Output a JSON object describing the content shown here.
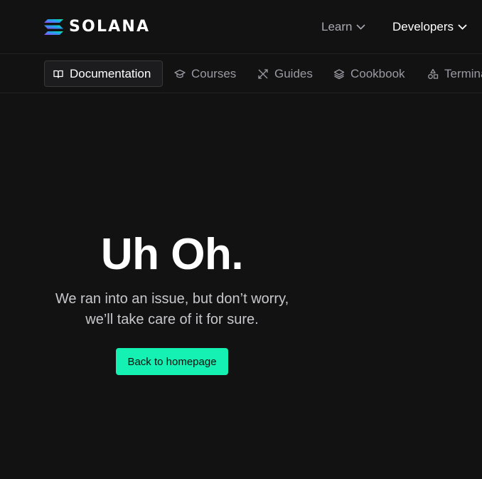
{
  "brand": {
    "name": "SOLANA",
    "logo_icon": "solana-logo-icon",
    "gradient": [
      "#9945ff",
      "#14f195",
      "#19fb9b"
    ]
  },
  "header": {
    "nav": [
      {
        "label": "Learn",
        "icon": "chevron-down-icon"
      },
      {
        "label": "Developers",
        "icon": "chevron-down-icon"
      }
    ]
  },
  "subnav": {
    "tabs": [
      {
        "label": "Documentation",
        "icon": "book-icon",
        "active": true
      },
      {
        "label": "Courses",
        "icon": "graduation-cap-icon"
      },
      {
        "label": "Guides",
        "icon": "tools-icon"
      },
      {
        "label": "Cookbook",
        "icon": "layers-icon"
      },
      {
        "label": "Terminal",
        "icon": "shapes-icon"
      }
    ]
  },
  "error": {
    "title": "Uh Oh.",
    "line1": "We ran into an issue, but don’t worry,",
    "line2": "we’ll take care of it for sure.",
    "button_label": "Back to homepage"
  },
  "colors": {
    "background": "#121212",
    "accent": "#14f1b2",
    "active_tab_bg": "#1c1c1e"
  }
}
